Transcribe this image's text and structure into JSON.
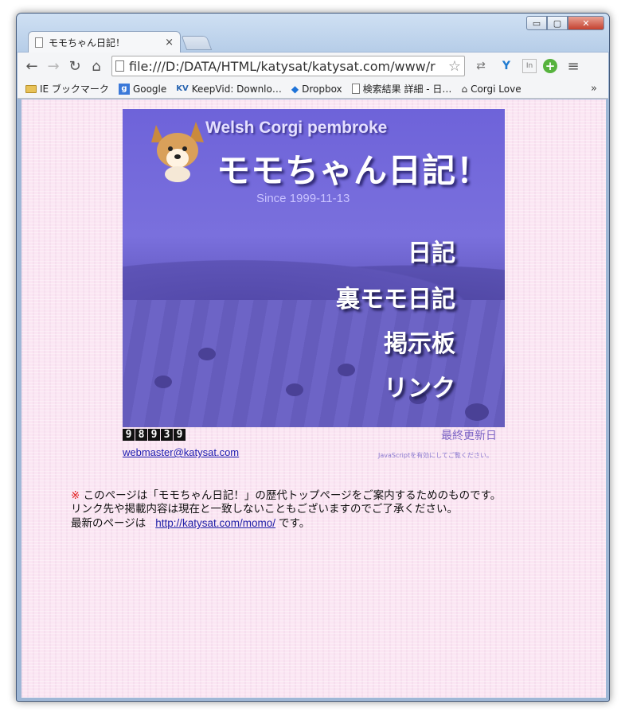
{
  "browser": {
    "tab_title": "モモちゃん日記！",
    "tab_close": "×",
    "url": "file:///D:/DATA/HTML/katysat/katysat.com/www/r",
    "window_buttons": {
      "minimize": "▭",
      "maximize": "▢",
      "close": "✕"
    }
  },
  "bookmarks": [
    {
      "label": "IE ブックマーク",
      "icon": "folder-icon"
    },
    {
      "label": "Google",
      "icon": "google-icon"
    },
    {
      "label": "KeepVid: Downlo…",
      "icon": "keepvid-icon"
    },
    {
      "label": "Dropbox",
      "icon": "dropbox-icon"
    },
    {
      "label": "検索結果 詳細 - 日…",
      "icon": "page-icon"
    },
    {
      "label": "Corgi Love",
      "icon": "bag-icon"
    }
  ],
  "bookmarks_more": "»",
  "banner": {
    "subtitle": "Welsh Corgi pembroke",
    "title": "モモちゃん日記！",
    "since": "Since 1999-11-13",
    "menu": [
      "日記",
      "裏モモ日記",
      "掲示板",
      "リンク"
    ]
  },
  "counter": [
    "9",
    "8",
    "9",
    "3",
    "9"
  ],
  "last_updated": "最終更新日",
  "email": "webmaster@katysat.com",
  "js_note": "JavaScriptを有効にしてご覧ください。",
  "notice": {
    "mark": "※",
    "line1": " このページは「モモちゃん日記！」の歴代トップページをご案内するためのものです。",
    "line2": "リンク先や掲載内容は現在と一致しないこともございますのでご了承ください。",
    "line3_prefix": "最新のページは",
    "link": "http://katysat.com/momo/",
    "line3_suffix": "です。"
  },
  "colors": {
    "page_bg": "#fbe6f3",
    "banner_bg": "#6e63d9",
    "link": "#1b1bb0",
    "updated": "#7b62c4",
    "notice_mark": "#e11a1a"
  }
}
